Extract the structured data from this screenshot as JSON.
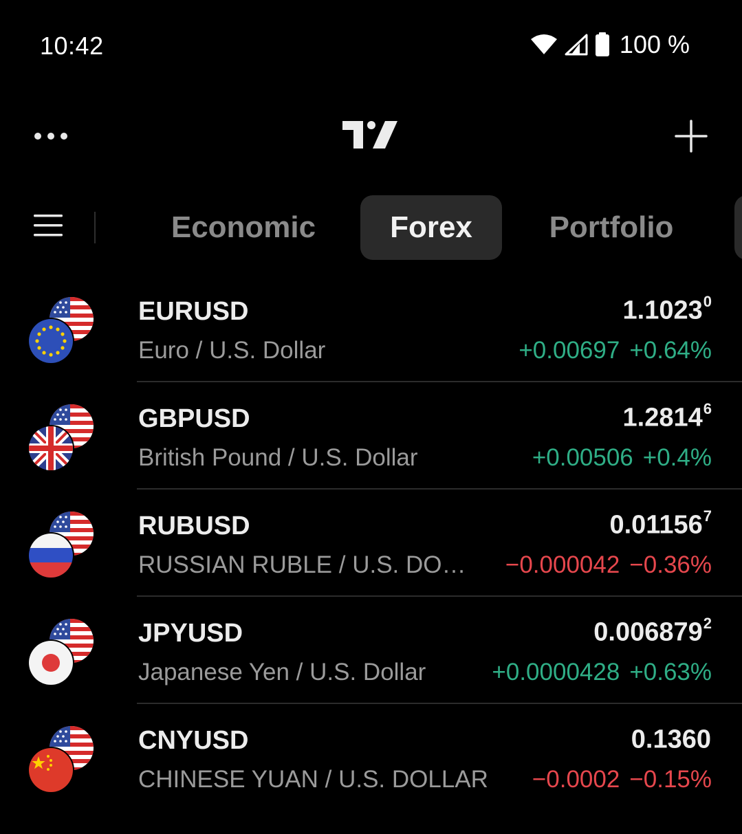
{
  "status": {
    "time": "10:42",
    "battery": "100 %",
    "icons": [
      "wifi-icon",
      "signal-icon",
      "battery-icon"
    ]
  },
  "header": {
    "logo": "TradingView logo",
    "icons": [
      "more-icon",
      "plus-icon"
    ]
  },
  "tabs": [
    {
      "label": "Economic",
      "active": false
    },
    {
      "label": "Forex",
      "active": true
    },
    {
      "label": "Portfolio",
      "active": false
    }
  ],
  "colors": {
    "background": "#000000",
    "positive": "#2fae86",
    "negative": "#e6474d",
    "active_tab": "#2a2a2a"
  },
  "watchlist": [
    {
      "symbol": "EURUSD",
      "description": "Euro / U.S. Dollar",
      "price": "1.1023",
      "price_super": "0",
      "change": "+0.00697",
      "change_pct": "+0.64%",
      "direction": "up",
      "flag": "eu-flag-icon"
    },
    {
      "symbol": "GBPUSD",
      "description": "British Pound / U.S. Dollar",
      "price": "1.2814",
      "price_super": "6",
      "change": "+0.00506",
      "change_pct": "+0.4%",
      "direction": "up",
      "flag": "uk-flag-icon"
    },
    {
      "symbol": "RUBUSD",
      "description": "RUSSIAN RUBLE / U.S. DOLL…",
      "price": "0.01156",
      "price_super": "7",
      "change": "−0.000042",
      "change_pct": "−0.36%",
      "direction": "down",
      "flag": "russia-flag-icon"
    },
    {
      "symbol": "JPYUSD",
      "description": "Japanese Yen / U.S. Dollar",
      "price": "0.006879",
      "price_super": "2",
      "change": "+0.0000428",
      "change_pct": "+0.63%",
      "direction": "up",
      "flag": "japan-flag-icon"
    },
    {
      "symbol": "CNYUSD",
      "description": "CHINESE YUAN / U.S. DOLLAR",
      "price": "0.1360",
      "price_super": "",
      "change": "−0.0002",
      "change_pct": "−0.15%",
      "direction": "down",
      "flag": "china-flag-icon"
    }
  ]
}
